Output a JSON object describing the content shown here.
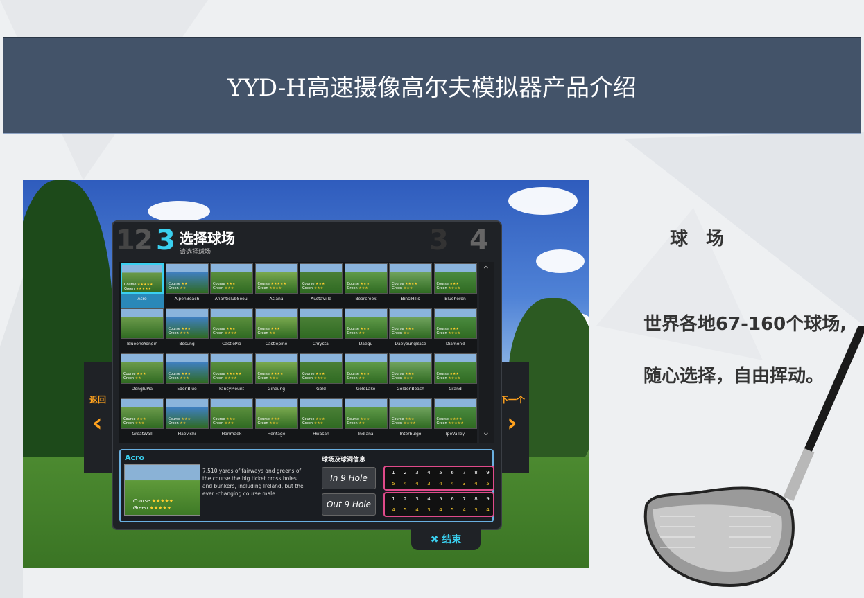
{
  "header": {
    "title": "YYD-H高速摄像高尔夫模拟器产品介绍"
  },
  "screenshot": {
    "steps": {
      "s1": "1",
      "s2": "2",
      "current": "3",
      "s3ghost": "3",
      "s4": "4"
    },
    "step_title": "选择球场",
    "step_subtitle": "请选择球场",
    "back_label": "返回",
    "next_label": "下一个",
    "end_label": "结束",
    "courses": [
      {
        "name": "Acro",
        "course": "★★★★★",
        "green": "★★★★★"
      },
      {
        "name": "AlpenBeach",
        "course": "★★",
        "green": "★★"
      },
      {
        "name": "AnanticlubSeoul",
        "course": "★★★",
        "green": "★★★"
      },
      {
        "name": "Asiana",
        "course": "★★★★★",
        "green": "★★★★"
      },
      {
        "name": "AustaVille",
        "course": "★★★",
        "green": "★★★"
      },
      {
        "name": "Bearcreek",
        "course": "★★★",
        "green": "★★★"
      },
      {
        "name": "BinsiHills",
        "course": "★★★★",
        "green": "★★★"
      },
      {
        "name": "Blueheron",
        "course": "★★★",
        "green": "★★★★"
      },
      {
        "name": "BlueoneYongin",
        "course": "",
        "green": ""
      },
      {
        "name": "Bosung",
        "course": "★★★",
        "green": "★★★"
      },
      {
        "name": "CastlePia",
        "course": "★★★",
        "green": "★★★★"
      },
      {
        "name": "Castlepine",
        "course": "★★★",
        "green": "★★"
      },
      {
        "name": "Chrystal",
        "course": "",
        "green": ""
      },
      {
        "name": "Daegu",
        "course": "★★★",
        "green": "★★"
      },
      {
        "name": "DaeyoungBase",
        "course": "★★★",
        "green": "★★"
      },
      {
        "name": "Diamond",
        "course": "★★★",
        "green": "★★★★"
      },
      {
        "name": "DongluPia",
        "course": "★★★",
        "green": "★★"
      },
      {
        "name": "EdenBlue",
        "course": "★★★",
        "green": "★★★"
      },
      {
        "name": "FancyMount",
        "course": "★★★★★",
        "green": "★★★★"
      },
      {
        "name": "Giheung",
        "course": "★★★★",
        "green": "★★★"
      },
      {
        "name": "Gold",
        "course": "★★★",
        "green": "★★★★"
      },
      {
        "name": "GoldLake",
        "course": "★★★",
        "green": "★★"
      },
      {
        "name": "GoldenBeach",
        "course": "★★★",
        "green": "★★★"
      },
      {
        "name": "Grand",
        "course": "★★★",
        "green": "★★★★"
      },
      {
        "name": "GreatWall",
        "course": "★★★",
        "green": "★★★"
      },
      {
        "name": "Haevichi",
        "course": "★★★",
        "green": "★★"
      },
      {
        "name": "Hanmaek",
        "course": "★★★",
        "green": "★★★"
      },
      {
        "name": "Heritage",
        "course": "★★★",
        "green": "★★★"
      },
      {
        "name": "Hwasan",
        "course": "★★★",
        "green": "★★★"
      },
      {
        "name": "Indiana",
        "course": "★★★",
        "green": "★★"
      },
      {
        "name": "Interbulgo",
        "course": "★★★",
        "green": "★★★★"
      },
      {
        "name": "IpeValley",
        "course": "★★★★",
        "green": "★★★★★"
      }
    ],
    "info": {
      "name": "Acro",
      "desc": "7,510 yards of fairways and greens of the course the big ticket cross holes and bunkers, including Ireland, but the ever -changing course male",
      "course_label": "Course",
      "green_label": "Green",
      "course_stars": "★★★★★",
      "green_stars": "★★★★★",
      "holes_title": "球场及球洞信息",
      "in_label": "In 9 Hole",
      "out_label": "Out 9 Hole",
      "in_holes": [
        "1",
        "2",
        "3",
        "4",
        "5",
        "6",
        "7",
        "8",
        "9"
      ],
      "in_par": [
        "5",
        "4",
        "4",
        "3",
        "4",
        "4",
        "3",
        "4",
        "5"
      ],
      "out_holes": [
        "1",
        "2",
        "3",
        "4",
        "5",
        "6",
        "7",
        "8",
        "9"
      ],
      "out_par": [
        "4",
        "5",
        "4",
        "3",
        "4",
        "5",
        "4",
        "3",
        "4"
      ]
    }
  },
  "right": {
    "heading": "球　场",
    "line1": "世界各地67-160个球场,",
    "line2": "随心选择，自由挥动。"
  },
  "colors": {
    "header": "#435369",
    "accent": "#ffa21e",
    "select": "#3ad0f0",
    "hole_border": "#e04a8a",
    "star": "#ffce2e"
  }
}
